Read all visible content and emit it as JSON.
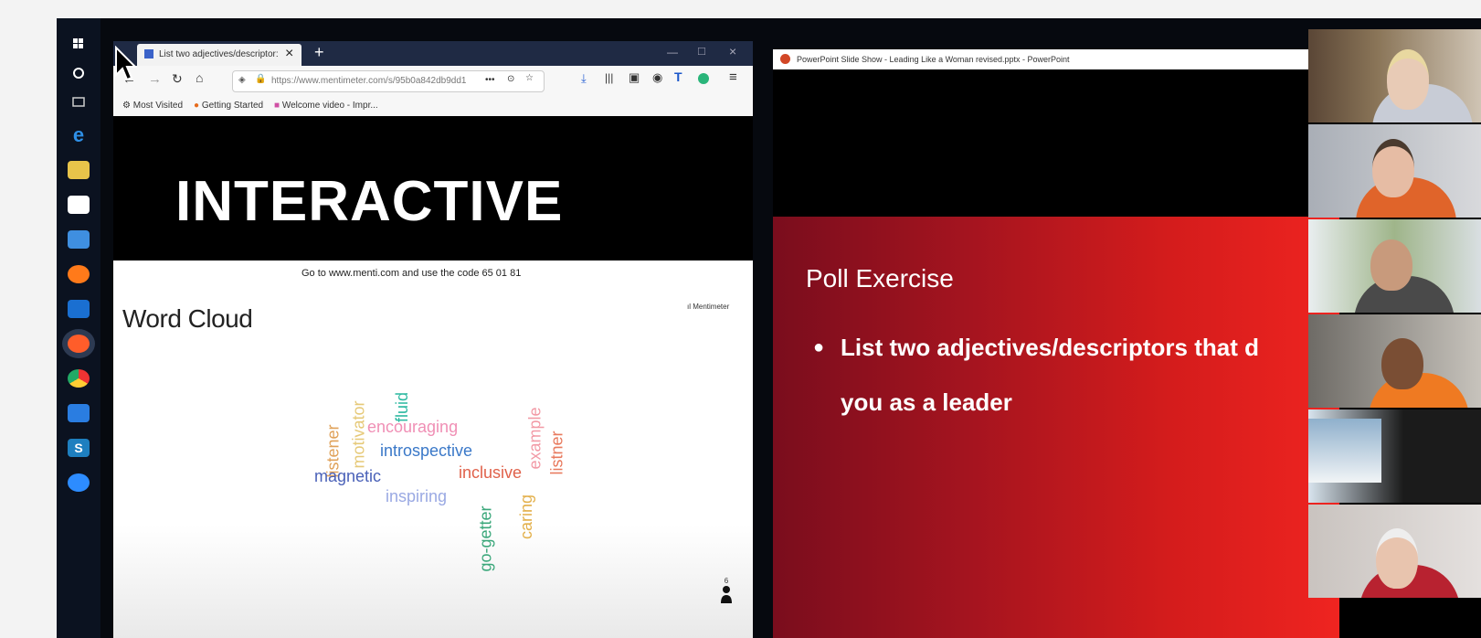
{
  "browser": {
    "tab_title": "List two adjectives/descriptor:",
    "new_tab_symbol": "+",
    "url": "https://www.mentimeter.com/s/95b0a842db9dd1",
    "url_menu": "•••",
    "bookmarks": [
      "Most Visited",
      "Getting Started",
      "Welcome video - Impr..."
    ]
  },
  "banner": {
    "text": "INTERACTIVE"
  },
  "mentimeter": {
    "instruction": "Go to www.menti.com and use the code 65 01 81",
    "brand": "Mentimeter",
    "heading": "Word Cloud",
    "participants_count": "6",
    "words": [
      {
        "text": "listener",
        "color": "#e0a25a"
      },
      {
        "text": "motivator",
        "color": "#e6c978"
      },
      {
        "text": "fluid",
        "color": "#2bb8a0"
      },
      {
        "text": "example",
        "color": "#f29aa6"
      },
      {
        "text": "listner",
        "color": "#e87a5e"
      },
      {
        "text": "encouraging",
        "color": "#f08fb5"
      },
      {
        "text": "introspective",
        "color": "#3a78c8"
      },
      {
        "text": "inclusive",
        "color": "#e0614a"
      },
      {
        "text": "magnetic",
        "color": "#4a61b8"
      },
      {
        "text": "inspiring",
        "color": "#9aa9e3"
      },
      {
        "text": "go-getter",
        "color": "#3aa77a"
      },
      {
        "text": "caring",
        "color": "#e3b04b"
      }
    ]
  },
  "powerpoint": {
    "window_title": "PowerPoint Slide Show - Leading Like a Woman revised.pptx - PowerPoint",
    "slide_title": "Poll Exercise",
    "bullet_line1": "List two adjectives/descriptors that d",
    "bullet_line2": "you as a leader"
  },
  "colors": {
    "accent_red": "#d41c1c",
    "taskbar": "#0b1220",
    "firefox_tabbar": "#1f2a44"
  }
}
